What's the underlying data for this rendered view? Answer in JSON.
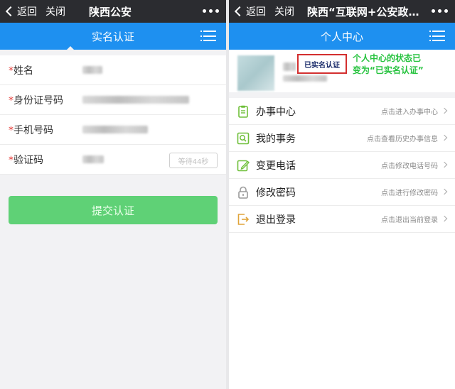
{
  "left": {
    "wechat": {
      "back_label": "返回",
      "close_label": "关闭",
      "title": "陕西公安"
    },
    "header": {
      "title": "实名认证"
    },
    "form": {
      "fields": [
        {
          "star": "*",
          "label": "姓名"
        },
        {
          "star": "*",
          "label": "身份证号码"
        },
        {
          "star": "*",
          "label": "手机号码"
        },
        {
          "star": "*",
          "label": "验证码"
        }
      ],
      "code_button": "等待44秒",
      "submit_label": "提交认证"
    }
  },
  "right": {
    "wechat": {
      "back_label": "返回",
      "close_label": "关闭",
      "title": "陕西“互联网+公安政务…"
    },
    "header": {
      "title": "个人中心"
    },
    "profile": {
      "verified_badge": "已实名认证",
      "annotation_line1": "个人中心的状态已",
      "annotation_line2": "变为“已实名认证”"
    },
    "menu": [
      {
        "title": "办事中心",
        "hint": "点击进入办事中心",
        "icon": "document-icon"
      },
      {
        "title": "我的事务",
        "hint": "点击查看历史办事信息",
        "icon": "search-icon"
      },
      {
        "title": "变更电话",
        "hint": "点击修改电话号码",
        "icon": "edit-icon"
      },
      {
        "title": "修改密码",
        "hint": "点击进行修改密码",
        "icon": "lock-icon"
      },
      {
        "title": "退出登录",
        "hint": "点击退出当前登录",
        "icon": "logout-icon"
      }
    ],
    "colors": {
      "icon_green": "#6fbf3a",
      "blue": "#1e90f0",
      "annotation_green": "#27c33f"
    }
  }
}
